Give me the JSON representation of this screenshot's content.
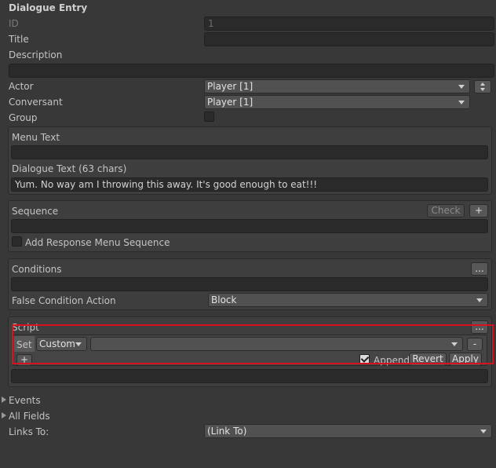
{
  "header": {
    "title": "Dialogue Entry"
  },
  "fields": {
    "id_label": "ID",
    "id_value": "1",
    "title_label": "Title",
    "title_value": "",
    "description_label": "Description",
    "description_value": "",
    "actor_label": "Actor",
    "actor_value": "Player [1]",
    "conversant_label": "Conversant",
    "conversant_value": "Player [1]",
    "group_label": "Group"
  },
  "text_panel": {
    "menu_text_label": "Menu Text",
    "menu_text_value": "",
    "dialogue_text_label": "Dialogue Text (63 chars)",
    "dialogue_text_value": "Yum. No way am I throwing this away. It's good enough to eat!!!"
  },
  "sequence_panel": {
    "label": "Sequence",
    "check_label": "Check",
    "add_label": "+",
    "value": "",
    "response_menu_label": "Add Response Menu Sequence"
  },
  "conditions_panel": {
    "label": "Conditions",
    "more_label": "...",
    "value": "",
    "false_action_label": "False Condition Action",
    "false_action_value": "Block"
  },
  "script_panel": {
    "label": "Script",
    "more_label": "...",
    "set_label": "Set",
    "type_value": "Custom",
    "variable_value": "",
    "remove_label": "-",
    "add_label": "+",
    "append_label": "Append",
    "revert_label": "Revert",
    "apply_label": "Apply",
    "value": ""
  },
  "footer": {
    "events_label": "Events",
    "all_fields_label": "All Fields",
    "links_to_label": "Links To:",
    "links_to_value": "(Link To)"
  },
  "colors": {
    "highlight": "#d7121e",
    "background": "#383838"
  },
  "icons": [
    "dropdown-arrow-icon",
    "foldout-arrow-icon",
    "checkmark-icon",
    "stepper-icon"
  ]
}
